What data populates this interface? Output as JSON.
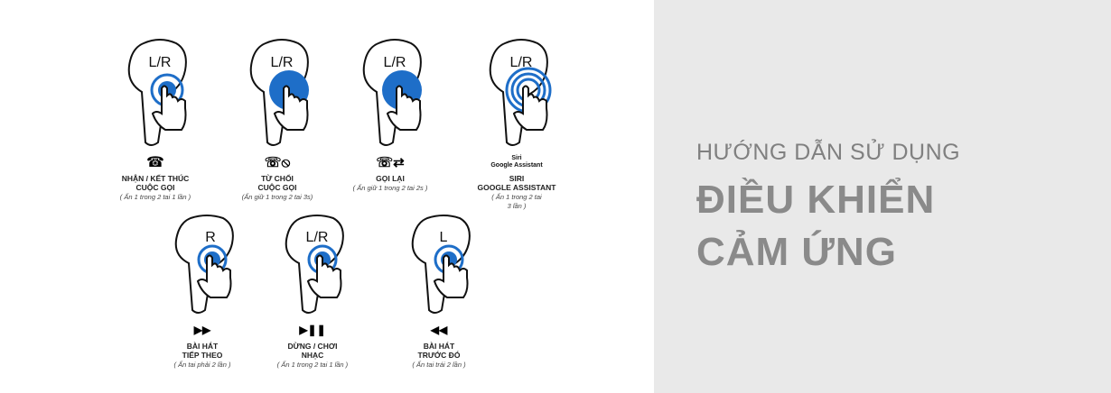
{
  "heading": {
    "subtitle": "HƯỚNG DẪN SỬ DỤNG",
    "title_line1": "ĐIỀU KHIỂN",
    "title_line2": "CẢM ỨNG"
  },
  "gestures": [
    {
      "badge": "L/R",
      "label1": "NHẬN / KẾT THÚC",
      "label2": "CUỘC GỌI",
      "note1": "( Ấn 1 trong 2 tai 1 lần )",
      "icon": "phone-hangup-icon"
    },
    {
      "badge": "L/R",
      "label1": "TỪ CHỐI",
      "label2": "CUỘC GỌI",
      "note1": "(Ấn giữ 1 trong 2 tai 3s)",
      "icon": "call-reject-icon"
    },
    {
      "badge": "L/R",
      "label1": "GỌI LẠI",
      "label2": "",
      "note1": "( Ấn giữ 1 trong 2 tai 2s )",
      "icon": "call-back-icon"
    },
    {
      "badge": "L/R",
      "label1": "SIRI",
      "label2": "GOOGLE ASSISTANT",
      "note1": "( Ấn 1 trong 2 tai",
      "note2": "3 lần )",
      "siri1": "Siri",
      "siri2": "Google Assistant",
      "icon": "voice-assistant-icon"
    },
    {
      "badge": "R",
      "label1": "BÀI HÁT",
      "label2": "TIẾP THEO",
      "note1": "( Ấn tai phải 2 lần )",
      "icon": "next-track-icon"
    },
    {
      "badge": "L/R",
      "label1": "DỪNG  / CHƠI",
      "label2": "NHẠC",
      "note1": "( Ấn 1 trong 2 tai 1 lần )",
      "icon": "play-pause-icon"
    },
    {
      "badge": "L",
      "label1": "BÀI HÁT",
      "label2": "TRƯỚC ĐÓ",
      "note1": "( Ấn tai trái 2 lần )",
      "icon": "previous-track-icon"
    }
  ],
  "colors": {
    "accent": "#1e6ec8",
    "panel_bg": "#e9e9e9",
    "title": "#8a8a8a"
  }
}
